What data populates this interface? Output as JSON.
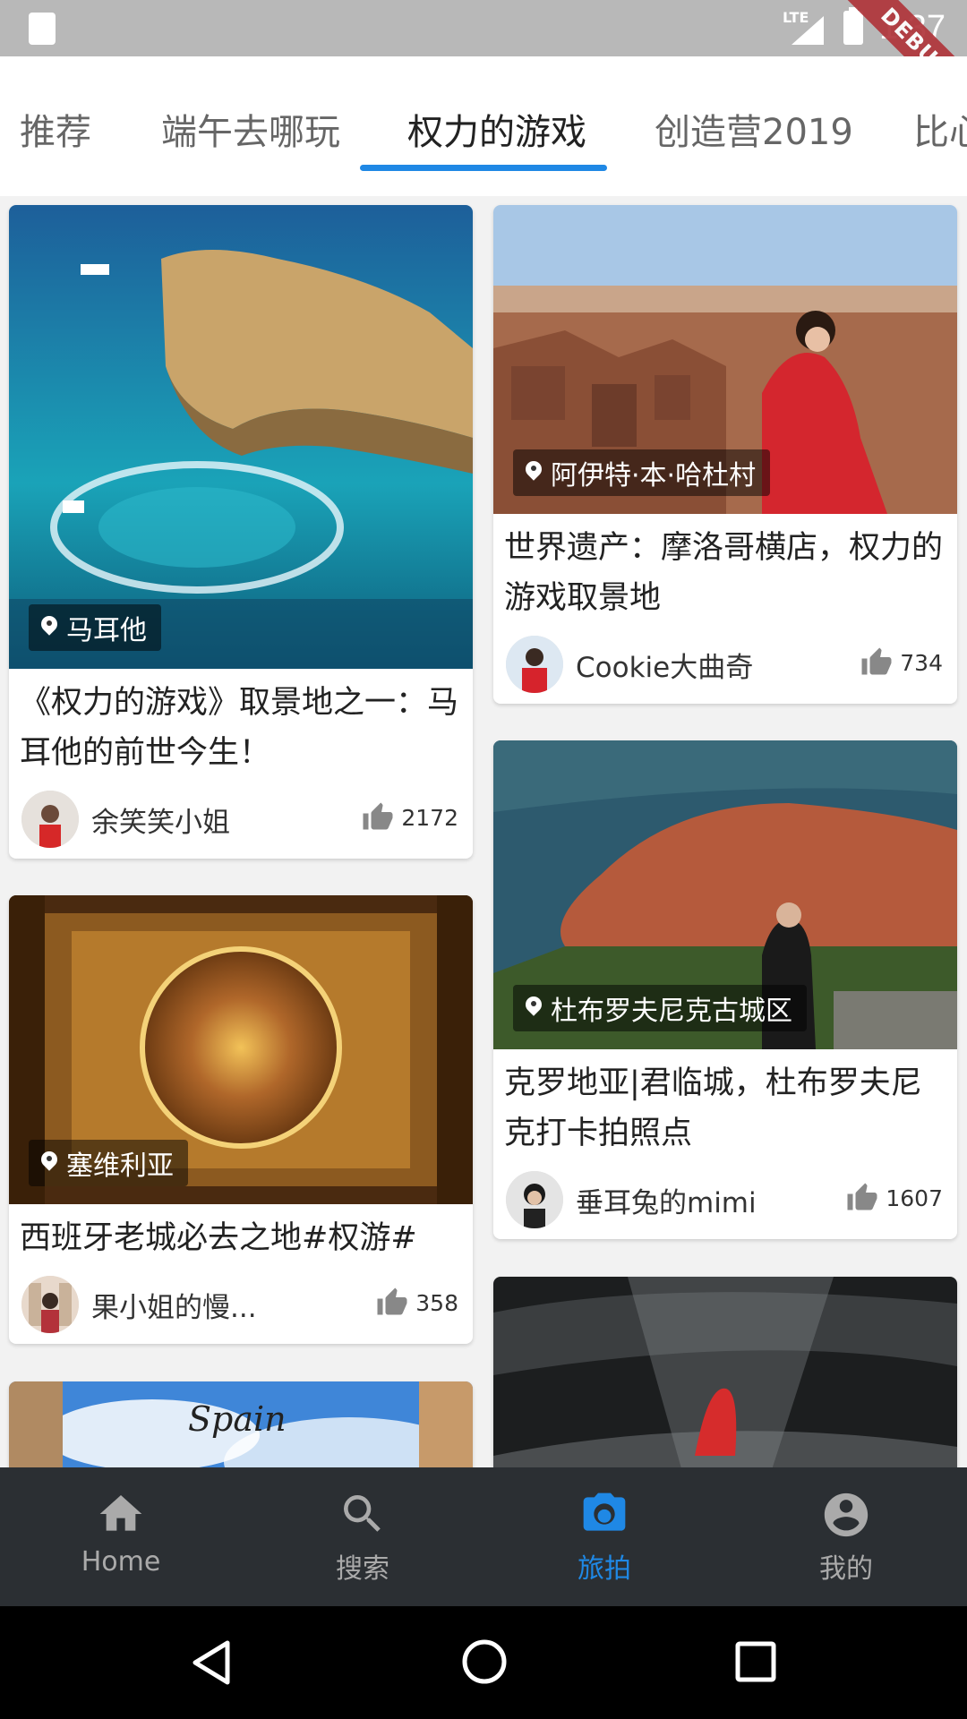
{
  "status_bar": {
    "time": "1:37",
    "network": "LTE",
    "debug_label": "DEBUG"
  },
  "tabs": [
    {
      "label": "推荐"
    },
    {
      "label": "端午去哪玩"
    },
    {
      "label": "权力的游戏",
      "active": true
    },
    {
      "label": "创造营2019"
    },
    {
      "label": "比心"
    }
  ],
  "cards": [
    {
      "location": "马耳他",
      "title": "《权力的游戏》取景地之一：马耳他的前世今生！",
      "author": "余笑笑小姐",
      "likes": "2172"
    },
    {
      "location": "阿伊特·本·哈杜村",
      "title": "世界遗产：摩洛哥横店，权力的游戏取景地",
      "author": "Cookie大曲奇",
      "likes": "734"
    },
    {
      "location": "塞维利亚",
      "title": "西班牙老城必去之地#权游#",
      "author": "果小姐的慢...",
      "likes": "358"
    },
    {
      "location": "杜布罗夫尼克古城区",
      "title": "克罗地亚|君临城，杜布罗夫尼克打卡拍照点",
      "author": "垂耳兔的mimi",
      "likes": "1607"
    },
    {
      "image_text": "Spain"
    }
  ],
  "bottom_nav": [
    {
      "label": "Home",
      "icon": "home-icon"
    },
    {
      "label": "搜索",
      "icon": "search-icon"
    },
    {
      "label": "旅拍",
      "icon": "camera-icon",
      "active": true
    },
    {
      "label": "我的",
      "icon": "account-icon"
    }
  ],
  "colors": {
    "accent": "#1f88e5",
    "nav_bg": "#2b2f33",
    "status_bar": "#b8b8b8"
  }
}
